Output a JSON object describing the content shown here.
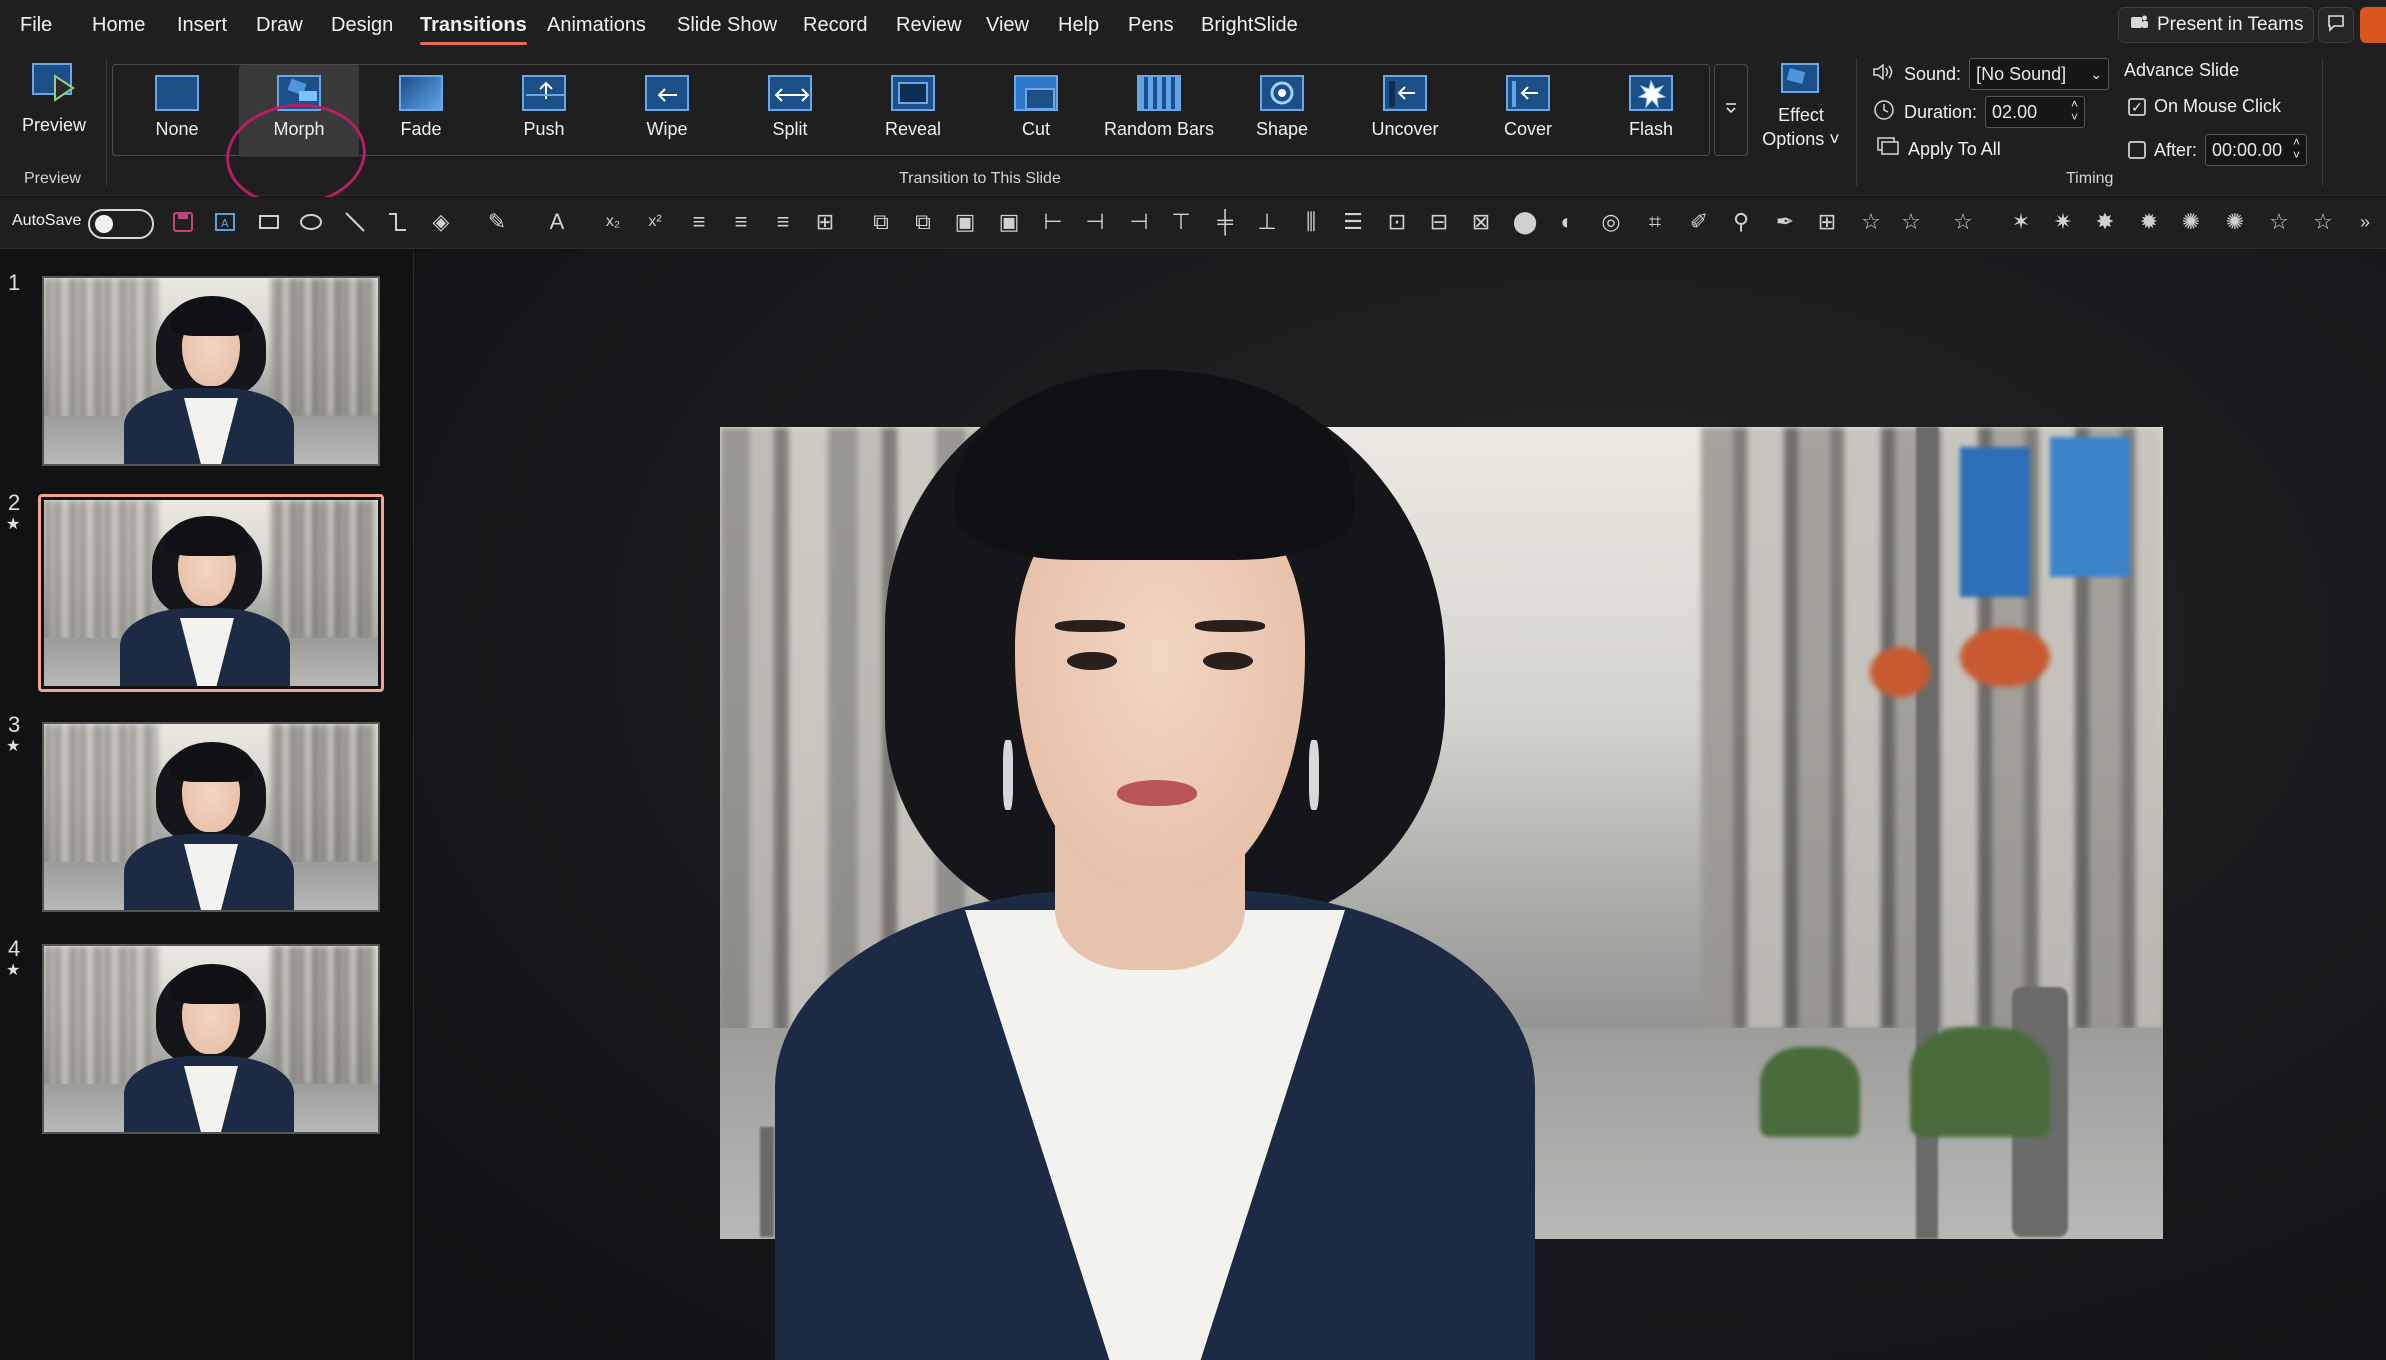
{
  "menu": {
    "items": [
      "File",
      "Home",
      "Insert",
      "Draw",
      "Design",
      "Transitions",
      "Animations",
      "Slide Show",
      "Record",
      "Review",
      "View",
      "Help",
      "Pens",
      "BrightSlide"
    ],
    "active": "Transitions",
    "present_in_teams": "Present in Teams"
  },
  "ribbon": {
    "preview": {
      "button_label": "Preview",
      "group_label": "Preview"
    },
    "transitions_group_label": "Transition to This Slide",
    "transitions": [
      {
        "label": "None",
        "icon": "none-transition-icon"
      },
      {
        "label": "Morph",
        "icon": "morph-transition-icon"
      },
      {
        "label": "Fade",
        "icon": "fade-transition-icon"
      },
      {
        "label": "Push",
        "icon": "push-transition-icon"
      },
      {
        "label": "Wipe",
        "icon": "wipe-transition-icon"
      },
      {
        "label": "Split",
        "icon": "split-transition-icon"
      },
      {
        "label": "Reveal",
        "icon": "reveal-transition-icon"
      },
      {
        "label": "Cut",
        "icon": "cut-transition-icon"
      },
      {
        "label": "Random Bars",
        "icon": "random-bars-transition-icon"
      },
      {
        "label": "Shape",
        "icon": "shape-transition-icon"
      },
      {
        "label": "Uncover",
        "icon": "uncover-transition-icon"
      },
      {
        "label": "Cover",
        "icon": "cover-transition-icon"
      },
      {
        "label": "Flash",
        "icon": "flash-transition-icon"
      }
    ],
    "selected_transition": "Morph",
    "effect_options": {
      "line1": "Effect",
      "line2": "Options"
    },
    "timing": {
      "sound_label": "Sound:",
      "sound_value": "[No Sound]",
      "duration_label": "Duration:",
      "duration_value": "02.00",
      "apply_to_all": "Apply To All",
      "advance_slide_label": "Advance Slide",
      "on_mouse_click_label": "On Mouse Click",
      "on_mouse_click_checked": true,
      "after_label": "After:",
      "after_checked": false,
      "after_value": "00:00.00",
      "group_label": "Timing"
    }
  },
  "qat": {
    "autosave_label": "AutoSave",
    "autosave_on": false
  },
  "slides": [
    {
      "number": "1",
      "star": ""
    },
    {
      "number": "2",
      "star": "★"
    },
    {
      "number": "3",
      "star": "★"
    },
    {
      "number": "4",
      "star": "★"
    }
  ],
  "selected_slide": 2,
  "colors": {
    "accent_underline": "#e86b5a",
    "annotation_circle": "#b51e66",
    "selected_slide_border": "#f2a58e",
    "share_button": "#d9571f"
  }
}
